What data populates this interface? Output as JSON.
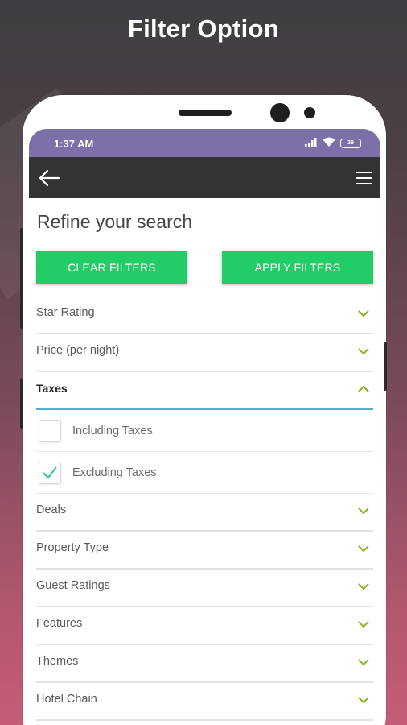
{
  "promo": {
    "title": "Filter Option"
  },
  "status_bar": {
    "time": "1:37 AM",
    "battery": "39"
  },
  "page": {
    "title": "Refine your search"
  },
  "actions": {
    "clear_label": "CLEAR FILTERS",
    "apply_label": "APPLY FILTERS"
  },
  "filters": [
    {
      "label": "Star Rating",
      "expanded": false
    },
    {
      "label": "Price (per night)",
      "expanded": false
    },
    {
      "label": "Taxes",
      "expanded": true
    }
  ],
  "tax_options": [
    {
      "label": "Including Taxes",
      "checked": false
    },
    {
      "label": "Excluding Taxes",
      "checked": true
    }
  ],
  "more_filters": [
    {
      "label": "Deals"
    },
    {
      "label": "Property Type"
    },
    {
      "label": "Guest Ratings"
    },
    {
      "label": "Features"
    },
    {
      "label": "Themes"
    },
    {
      "label": "Hotel Chain"
    }
  ],
  "colors": {
    "status_bar": "#7d6fa8",
    "app_bar": "#333333",
    "accent_green": "#22cc66",
    "chevron": "#8ab31f",
    "open_underline": "#4fb1c7",
    "check": "#2ec4a0"
  }
}
